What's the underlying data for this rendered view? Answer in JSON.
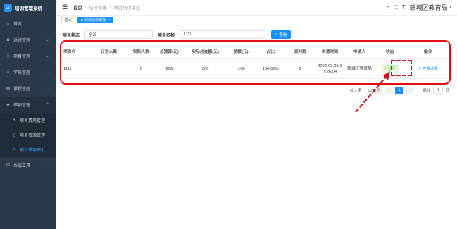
{
  "app": {
    "title": "培训管理系统",
    "logo_glyph": "⊡"
  },
  "sidebar": {
    "items": [
      {
        "label": "首页",
        "icon": "home-icon",
        "glyph": "⌂"
      },
      {
        "label": "系统管理",
        "icon": "gear-icon",
        "glyph": "✿",
        "arrow": "⌄"
      },
      {
        "label": "项目管理",
        "icon": "list-icon",
        "glyph": "≡",
        "arrow": "⌄"
      },
      {
        "label": "学员管理",
        "icon": "user-icon",
        "glyph": "♙",
        "arrow": "⌄"
      },
      {
        "label": "课程管理",
        "icon": "book-icon",
        "glyph": "▤",
        "arrow": "⌄"
      },
      {
        "label": "结项管理",
        "icon": "briefcase-icon",
        "glyph": "▰",
        "arrow": "⌃"
      }
    ],
    "sub_items": [
      {
        "label": "项目费用管理",
        "icon": "yen-icon",
        "glyph": "¥"
      },
      {
        "label": "项目资源管理",
        "icon": "file-icon",
        "glyph": "▯"
      },
      {
        "label": "项目结项审批",
        "icon": "edit-icon",
        "glyph": "✎"
      }
    ],
    "tools": {
      "label": "系统工具",
      "icon": "toolbox-icon",
      "glyph": "⊞",
      "arrow": "⌄"
    }
  },
  "header": {
    "breadcrumb": [
      "首页",
      "结项管理",
      "项目结项审批"
    ],
    "separator": "/",
    "user_name": "赣城区教育局",
    "caret": "▾",
    "icons": {
      "search": "⌕",
      "fullscreen": "⛶",
      "font": "T"
    }
  },
  "tags": {
    "home": "首页",
    "current": "项目结项审批",
    "close": "×"
  },
  "filter": {
    "status_label": "项目状态",
    "status_value": "全部",
    "name_label": "项目名称",
    "name_value": "1111",
    "search_label": "查询",
    "search_icon": "⌕",
    "caret": "⌄"
  },
  "table": {
    "headers": [
      "项目名",
      "计划人数",
      "实际人数",
      "总预算(元)",
      "实际总金额(元)",
      "差额(元)",
      "占比",
      "资料数",
      "申请时间",
      "申请人",
      "状态",
      "操作"
    ],
    "rows": [
      {
        "name": "1111",
        "plan": "",
        "actual": "0",
        "budget": "200",
        "total": "300",
        "diff": "-100",
        "ratio": "150.00%",
        "docs": "2",
        "time_a": "2022-03-21 1",
        "time_b": "7:26:04",
        "applicant": "赣城区教育局",
        "status": "已结项",
        "action": "查看详情",
        "action_icon": "✎"
      }
    ]
  },
  "pagination": {
    "total_text": "共 1 条",
    "page_size": "10条/页",
    "prev": "‹",
    "next": "›",
    "current": "1",
    "goto_label": "前往",
    "goto_value": "1",
    "unit": "页"
  },
  "colors": {
    "sidebar": "#2b3a4a",
    "accent": "#1890ff",
    "annotation": "#e01010",
    "success": "#67c23a"
  }
}
